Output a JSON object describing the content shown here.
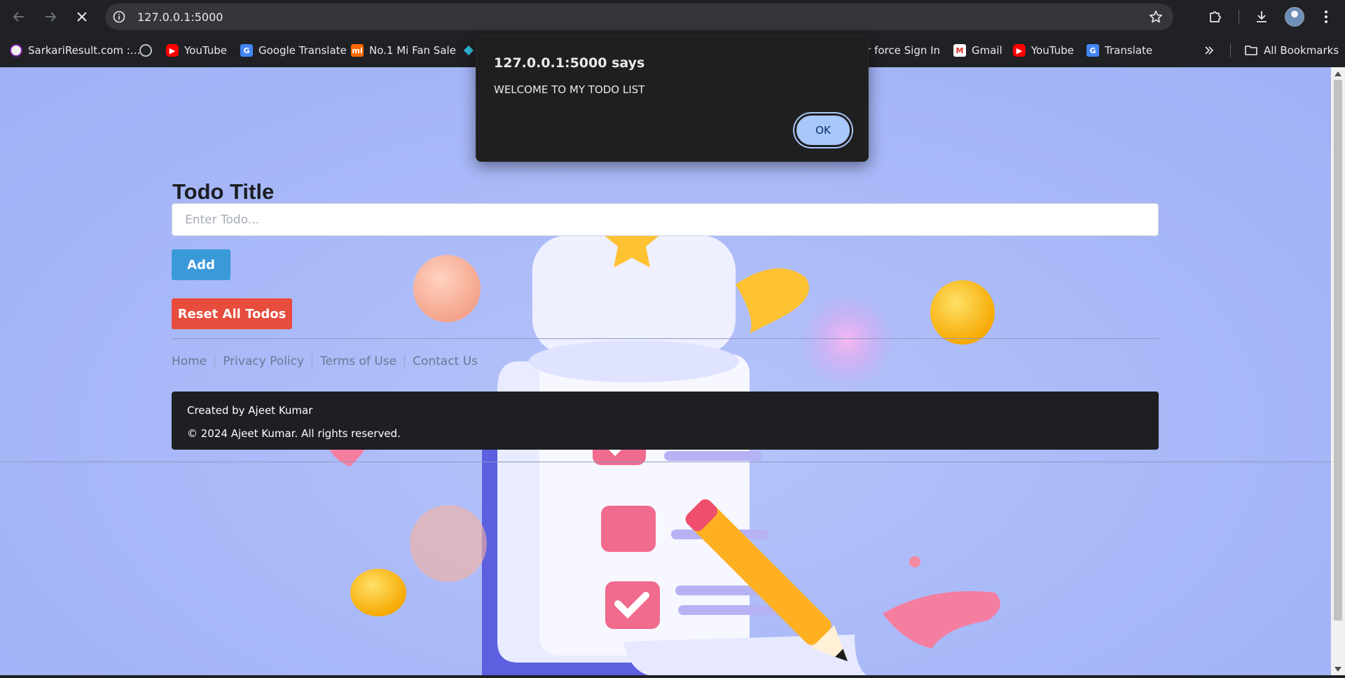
{
  "browser": {
    "url": "127.0.0.1:5000",
    "bookmarks": [
      {
        "label": "SarkariResult.com :...",
        "icon": "sarkari-result-favicon"
      },
      {
        "label": "",
        "icon": "globe-icon"
      },
      {
        "label": "YouTube",
        "icon": "youtube-favicon"
      },
      {
        "label": "Google Translate",
        "icon": "google-translate-favicon"
      },
      {
        "label": "No.1 Mi Fan Sale",
        "icon": "mi-favicon"
      },
      {
        "label": "",
        "icon": "diamond-favicon"
      },
      {
        "label": "ir force Sign In",
        "icon": ""
      },
      {
        "label": "Gmail",
        "icon": "gmail-favicon"
      },
      {
        "label": "YouTube",
        "icon": "youtube-favicon"
      },
      {
        "label": "Translate",
        "icon": "google-translate-favicon"
      }
    ],
    "all_bookmarks": "All Bookmarks"
  },
  "page": {
    "heading": "Todo Title",
    "input_placeholder": "Enter Todo...",
    "add_label": "Add",
    "reset_label": "Reset All Todos",
    "footer_links": [
      "Home",
      "Privacy Policy",
      "Terms of Use",
      "Contact Us"
    ],
    "created_by": "Created by Ajeet Kumar",
    "copyright": "© 2024 Ajeet Kumar. All rights reserved."
  },
  "dialog": {
    "title": "127.0.0.1:5000 says",
    "message": "WELCOME TO MY TODO LIST",
    "ok_label": "OK"
  },
  "colors": {
    "add_button": "#3a9ad9",
    "reset_button": "#e74c3c",
    "dialog_ok": "#a8c7fa",
    "page_background": "#a8b8f8"
  }
}
